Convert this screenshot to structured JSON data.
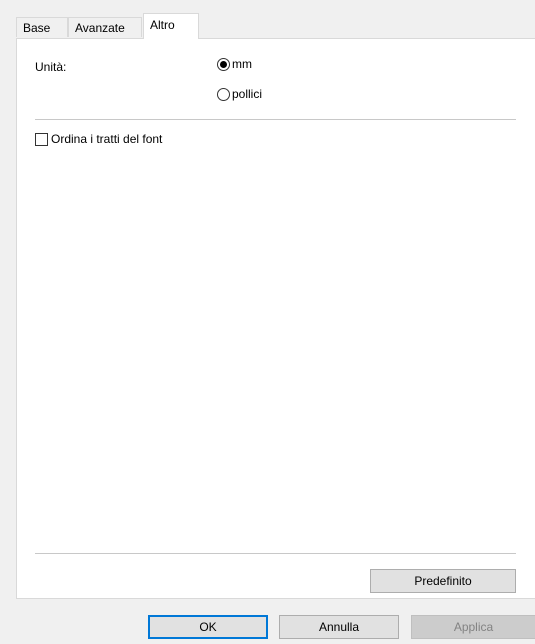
{
  "tabs": {
    "base": "Base",
    "avanzate": "Avanzate",
    "altro": "Altro",
    "active": "Altro"
  },
  "units": {
    "label": "Unità:",
    "options": [
      "mm",
      "pollici"
    ],
    "selected": "mm"
  },
  "font_strokes": {
    "label": "Ordina i tratti del font",
    "checked": false
  },
  "buttons": {
    "default": "Predefinito",
    "ok": "OK",
    "cancel": "Annulla",
    "apply": "Applica",
    "apply_enabled": false
  },
  "colors": {
    "focus_border": "#0078d7",
    "disabled_text": "#838383"
  }
}
